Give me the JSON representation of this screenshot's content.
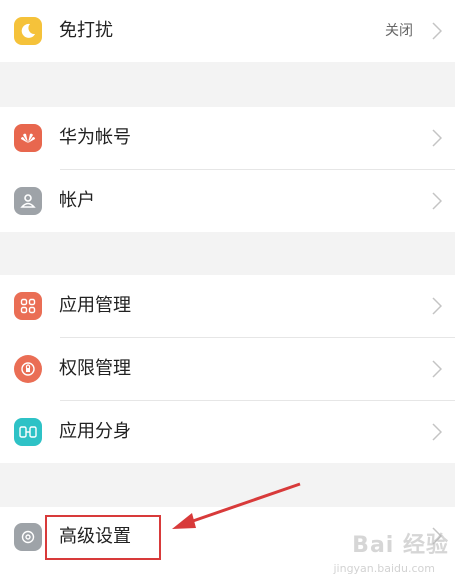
{
  "colors": {
    "dnd": "#f5c23a",
    "huawei": "#e8674e",
    "account": "#9ea3a8",
    "appmgr": "#ea6e55",
    "perm": "#ea6e55",
    "twin": "#2ec2c6",
    "advanced": "#9ea3a8",
    "annotation": "#d83a3a"
  },
  "settings": {
    "dnd": {
      "label": "免打扰",
      "value": "关闭",
      "icon": "moon-icon"
    },
    "huawei_id": {
      "label": "华为帐号",
      "icon": "huawei-logo-icon"
    },
    "accounts": {
      "label": "帐户",
      "icon": "person-icon"
    },
    "app_manager": {
      "label": "应用管理",
      "icon": "grid-icon"
    },
    "permissions": {
      "label": "权限管理",
      "icon": "shield-lock-icon"
    },
    "app_twin": {
      "label": "应用分身",
      "icon": "twin-icon"
    },
    "advanced": {
      "label": "高级设置",
      "icon": "gear-icon"
    }
  },
  "watermark": {
    "main": "Bai 经验",
    "sub": "jingyan.baidu.com"
  }
}
